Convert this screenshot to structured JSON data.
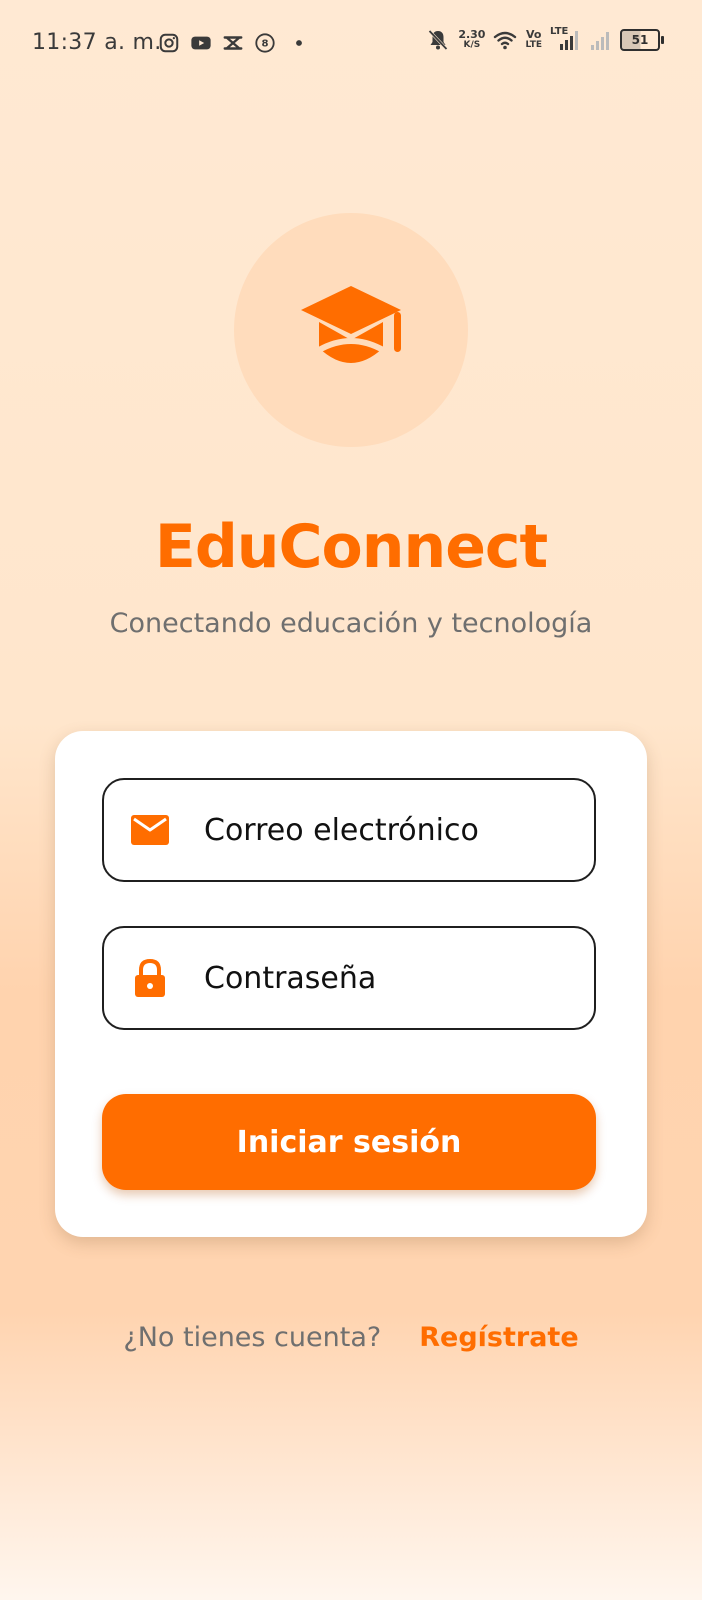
{
  "status_bar": {
    "time": "11:37 a. m.",
    "net_speed_value": "2.30",
    "net_speed_unit": "K/S",
    "volte_top": "Vo",
    "volte_bottom": "LTE",
    "lte_label": "LTE",
    "battery_level": "51",
    "app_icons": [
      "instagram-icon",
      "youtube-icon",
      "capcut-icon",
      "circle-8-icon",
      "dot-icon"
    ],
    "right_icons": [
      "bell-muted-icon",
      "wifi-icon",
      "signal-icon",
      "signal-weak-icon",
      "battery-icon"
    ]
  },
  "brand": {
    "logo_icon": "graduation-cap-icon",
    "name": "EduConnect",
    "tagline": "Conectando educación y tecnología",
    "accent_color": "#FF6D00"
  },
  "login_form": {
    "email_placeholder": "Correo electrónico",
    "email_icon": "mail-icon",
    "password_placeholder": "Contraseña",
    "password_icon": "lock-icon",
    "submit_label": "Iniciar sesión"
  },
  "signup": {
    "question": "¿No tienes cuenta?",
    "link_label": "Regístrate"
  }
}
